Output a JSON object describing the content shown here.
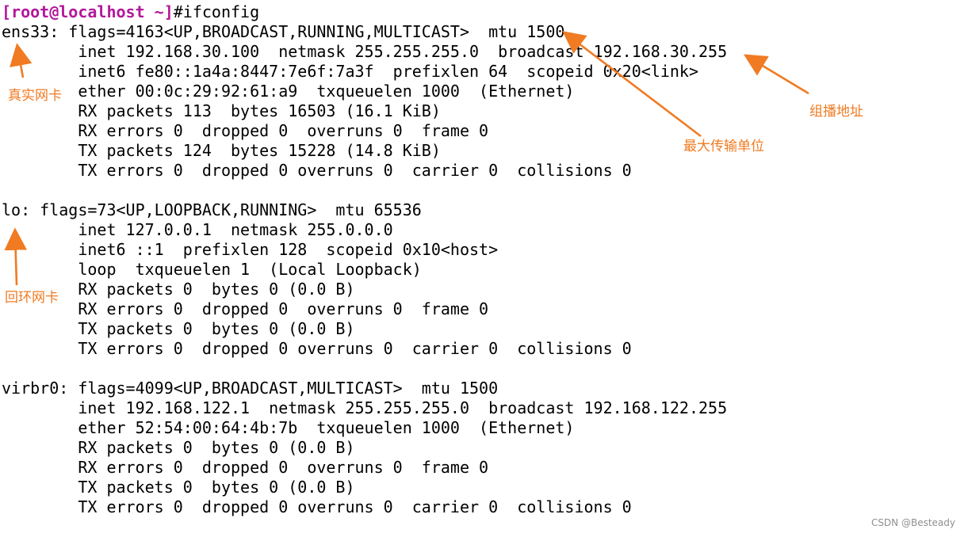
{
  "terminal": {
    "prompt": "[root@localhost ~]",
    "command": "#ifconfig",
    "lines": [
      "ens33: flags=4163<UP,BROADCAST,RUNNING,MULTICAST>  mtu 1500",
      "        inet 192.168.30.100  netmask 255.255.255.0  broadcast 192.168.30.255",
      "        inet6 fe80::1a4a:8447:7e6f:7a3f  prefixlen 64  scopeid 0x20<link>",
      "        ether 00:0c:29:92:61:a9  txqueuelen 1000  (Ethernet)",
      "        RX packets 113  bytes 16503 (16.1 KiB)",
      "        RX errors 0  dropped 0  overruns 0  frame 0",
      "        TX packets 124  bytes 15228 (14.8 KiB)",
      "        TX errors 0  dropped 0 overruns 0  carrier 0  collisions 0",
      "",
      "lo: flags=73<UP,LOOPBACK,RUNNING>  mtu 65536",
      "        inet 127.0.0.1  netmask 255.0.0.0",
      "        inet6 ::1  prefixlen 128  scopeid 0x10<host>",
      "        loop  txqueuelen 1  (Local Loopback)",
      "        RX packets 0  bytes 0 (0.0 B)",
      "        RX errors 0  dropped 0  overruns 0  frame 0",
      "        TX packets 0  bytes 0 (0.0 B)",
      "        TX errors 0  dropped 0 overruns 0  carrier 0  collisions 0",
      "",
      "virbr0: flags=4099<UP,BROADCAST,MULTICAST>  mtu 1500",
      "        inet 192.168.122.1  netmask 255.255.255.0  broadcast 192.168.122.255",
      "        ether 52:54:00:64:4b:7b  txqueuelen 1000  (Ethernet)",
      "        RX packets 0  bytes 0 (0.0 B)",
      "        RX errors 0  dropped 0  overruns 0  frame 0",
      "        TX packets 0  bytes 0 (0.0 B)",
      "        TX errors 0  dropped 0 overruns 0  carrier 0  collisions 0"
    ]
  },
  "annotations": {
    "real_nic": "真实网卡",
    "broadcast_addr": "组播地址",
    "mtu": "最大传输单位",
    "loopback_nic": "回环网卡"
  },
  "colors": {
    "prompt": "#b3179b",
    "annotation": "#f07b22",
    "terminal_text": "#000000",
    "background": "#ffffff"
  },
  "watermark": "CSDN @Besteady"
}
